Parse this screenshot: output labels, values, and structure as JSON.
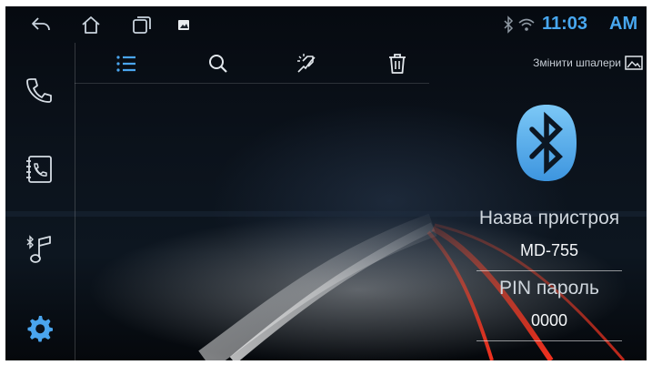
{
  "status_bar": {
    "icons": [
      "back-icon",
      "home-icon",
      "recent-apps-icon",
      "gallery-icon",
      "bluetooth-icon",
      "wifi-icon"
    ],
    "time": "11:03",
    "ampm": "AM",
    "accent_color": "#48a7ef"
  },
  "sidebar": {
    "items": [
      {
        "icon": "phone-icon"
      },
      {
        "icon": "contacts-icon"
      },
      {
        "icon": "bluetooth-music-icon"
      },
      {
        "icon": "settings-icon",
        "active": true
      }
    ]
  },
  "toolbar": {
    "items": [
      {
        "icon": "list-icon",
        "active": true
      },
      {
        "icon": "search-icon"
      },
      {
        "icon": "pair-device-icon"
      },
      {
        "icon": "delete-icon"
      }
    ]
  },
  "wallpaper": {
    "label": "Змінити шпалери",
    "icon": "image-icon"
  },
  "device": {
    "logo": "bluetooth-logo",
    "name_label": "Назва пристроя",
    "name_value": "MD-755",
    "pin_label": "PIN пароль",
    "pin_value": "0000"
  }
}
